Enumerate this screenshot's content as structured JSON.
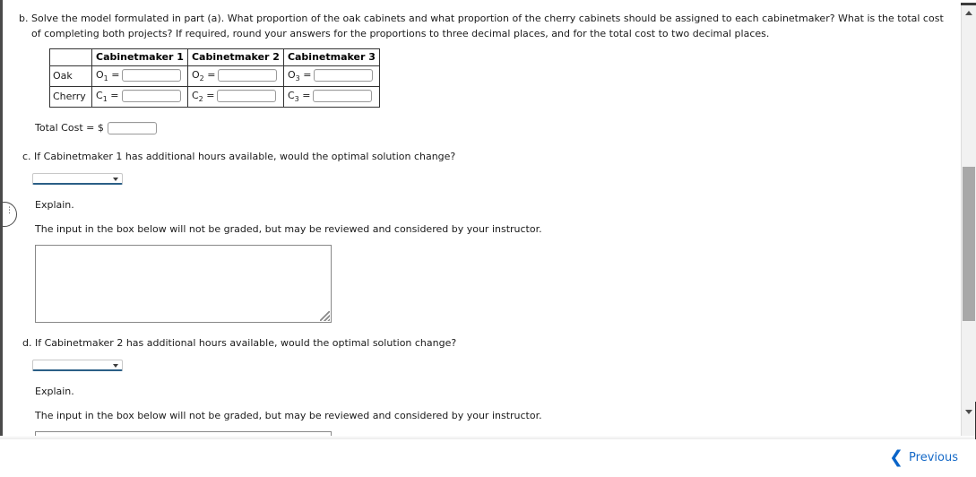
{
  "question_b": {
    "marker": "b.",
    "text": "Solve the model formulated in part (a). What proportion of the oak cabinets and what proportion of the cherry cabinets should be assigned to each cabinetmaker? What is the total cost of completing both projects? If required, round your answers for the proportions to three decimal places, and for the total cost to two decimal places."
  },
  "table": {
    "corner_header": "",
    "column_headers": [
      "Cabinetmaker 1",
      "Cabinetmaker 2",
      "Cabinetmaker 3"
    ],
    "rows": [
      {
        "row_header": "Oak",
        "cells": [
          {
            "var": "O",
            "sub": "1",
            "eq": "=",
            "value": ""
          },
          {
            "var": "O",
            "sub": "2",
            "eq": "=",
            "value": ""
          },
          {
            "var": "O",
            "sub": "3",
            "eq": "=",
            "value": ""
          }
        ]
      },
      {
        "row_header": "Cherry",
        "cells": [
          {
            "var": "C",
            "sub": "1",
            "eq": "=",
            "value": ""
          },
          {
            "var": "C",
            "sub": "2",
            "eq": "=",
            "value": ""
          },
          {
            "var": "C",
            "sub": "3",
            "eq": "=",
            "value": ""
          }
        ]
      }
    ]
  },
  "total_cost": {
    "label": "Total Cost = $",
    "value": ""
  },
  "question_c": {
    "marker": "c.",
    "text": "If Cabinetmaker 1 has additional hours available, would the optimal solution change?",
    "dropdown_value": "",
    "explain_label": "Explain.",
    "notice": "The input in the box below will not be graded, but may be reviewed and considered by your instructor.",
    "answer_value": ""
  },
  "question_d": {
    "marker": "d.",
    "text": "If Cabinetmaker 2 has additional hours available, would the optimal solution change?",
    "dropdown_value": "",
    "explain_label": "Explain.",
    "notice": "The input in the box below will not be graded, but may be reviewed and considered by your instructor.",
    "answer_value": ""
  },
  "footer": {
    "previous_label": "Previous",
    "previous_icon": "chevron-left-icon",
    "link_color": "#1569c7"
  },
  "scrollbar": {
    "up_icon": "triangle-up-icon",
    "down_icon": "triangle-down-icon"
  },
  "side_handle": {
    "icon": "vertical-ellipsis-icon"
  }
}
